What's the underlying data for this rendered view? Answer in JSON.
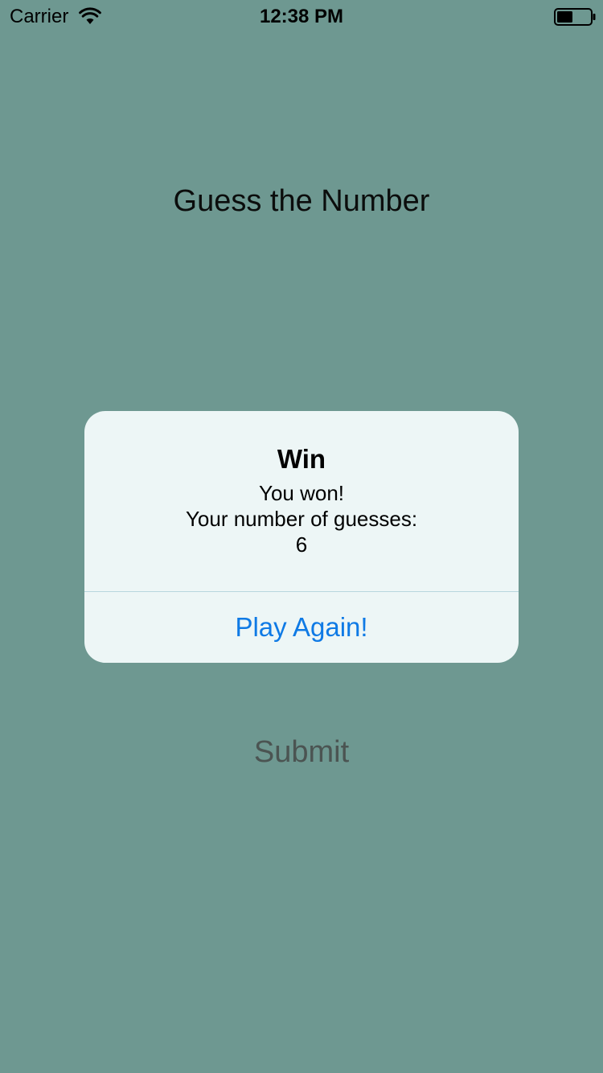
{
  "status_bar": {
    "carrier": "Carrier",
    "time": "12:38 PM",
    "wifi_icon": "wifi-icon",
    "battery_icon": "battery-icon"
  },
  "main": {
    "title": "Guess the Number",
    "submit_label": "Submit"
  },
  "alert": {
    "title": "Win",
    "message_line1": "You won!",
    "message_line2": "Your number of guesses:",
    "guess_count": "6",
    "action_label": "Play Again!"
  },
  "colors": {
    "background": "#6e9891",
    "alert_background": "#edf6f6",
    "action_blue": "#0f7ae5",
    "submit_text": "#4b5452"
  }
}
